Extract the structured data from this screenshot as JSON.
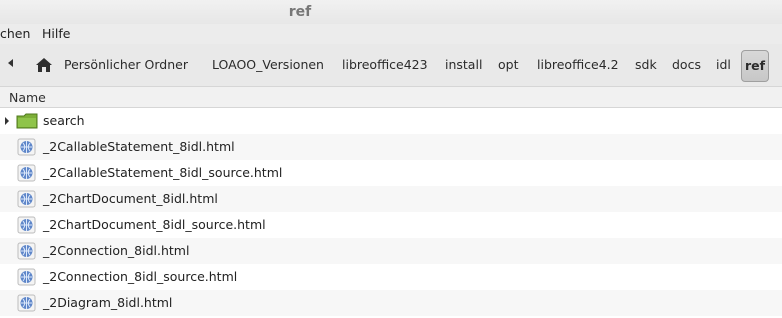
{
  "window": {
    "title": "ref"
  },
  "menubar": {
    "items": [
      {
        "label": "chen"
      },
      {
        "label": "Hilfe"
      }
    ]
  },
  "breadcrumbs": [
    {
      "label": "Persönlicher Ordner"
    },
    {
      "label": "LOAOO_Versionen"
    },
    {
      "label": "libreoffice423"
    },
    {
      "label": "install"
    },
    {
      "label": "opt"
    },
    {
      "label": "libreoffice4.2"
    },
    {
      "label": "sdk"
    },
    {
      "label": "docs"
    },
    {
      "label": "idl"
    },
    {
      "label": "ref"
    }
  ],
  "list": {
    "column_header": "Name",
    "items": [
      {
        "name": "search",
        "icon": "folder-icon"
      },
      {
        "name": "_2CallableStatement_8idl.html",
        "icon": "web-page-icon"
      },
      {
        "name": "_2CallableStatement_8idl_source.html",
        "icon": "web-page-icon"
      },
      {
        "name": "_2ChartDocument_8idl.html",
        "icon": "web-page-icon"
      },
      {
        "name": "_2ChartDocument_8idl_source.html",
        "icon": "web-page-icon"
      },
      {
        "name": "_2Connection_8idl.html",
        "icon": "web-page-icon"
      },
      {
        "name": "_2Connection_8idl_source.html",
        "icon": "web-page-icon"
      },
      {
        "name": "_2Diagram_8idl.html",
        "icon": "web-page-icon"
      }
    ]
  },
  "colors": {
    "toolbar": "#e9e9e9",
    "active_crumb": "#cfcfcf",
    "folder": "#76a934",
    "web_icon": "#5e86c9"
  }
}
